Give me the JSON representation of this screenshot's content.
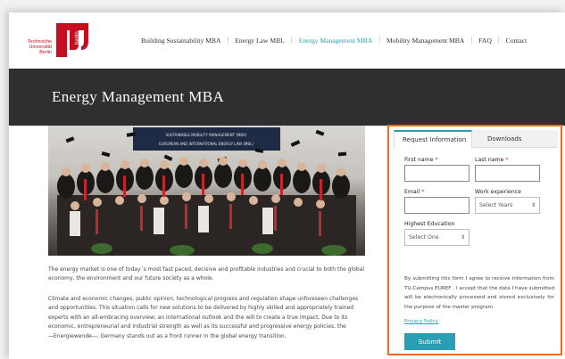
{
  "logo": {
    "line1": "Technische",
    "line2": "Universität",
    "line3": "Berlin",
    "mark_text": "berlin",
    "color": "#c50e1f",
    "icon": "tu-berlin-logo"
  },
  "nav": {
    "items": [
      {
        "label": "Building Sustainability MBA"
      },
      {
        "label": "Energy Law MBL"
      },
      {
        "label": "Energy Management MBA",
        "active": true
      },
      {
        "label": "Mobility Management MBA"
      },
      {
        "label": "FAQ"
      },
      {
        "label": "Contact"
      }
    ],
    "separator": "|",
    "active_color": "#2a9fb3"
  },
  "banner": {
    "title": "Energy Management MBA",
    "background": "#2f2f2f"
  },
  "photo": {
    "banner_text_1": "EUROPEAN AND INTERNATIONAL ENERGY LAW (MBL)",
    "banner_text_2": "SUSTAINABLE MOBILITY MANAGEMENT (MBA)"
  },
  "content": {
    "paragraph_1": "The energy market is one of today´s most fast paced, decisive and profitable industries and crucial to both the global economy, the environment and our future society as a whole.",
    "paragraph_2": "Climate and economic changes, public opinion, technological progress and regulation shape unforeseen challenges and opportunities. This situation calls for new solutions to be delivered by highly skilled and appropriately trained experts with an all-embracing overview, an international outlook and the will to create a true impact. Due to its economic, entrepreneurial and industrial strength as well as its successful and progressive energy policies, the ―Energiewende―, Germany stands out as a front runner in the global energy transition."
  },
  "form": {
    "highlight_color": "#f26b21",
    "tabs": {
      "request": "Request Information",
      "downloads": "Downloads"
    },
    "first_name_label": "First name",
    "last_name_label": "Last name",
    "email_label": "Email",
    "work_experience_label": "Work experience",
    "work_experience_value": "Select Years",
    "education_label": "Highest Education",
    "education_value": "Select One",
    "required_mark": "*",
    "consent_text": "By submitting this form I agree to receive information from TU-Campus EUREF . I accept that the data I have submitted will be electronically processed and stored exclusively for the purpose of the master program.",
    "privacy_label": "Privacy Policy",
    "submit_label": "Submit",
    "accent_color": "#2a9fb3"
  }
}
